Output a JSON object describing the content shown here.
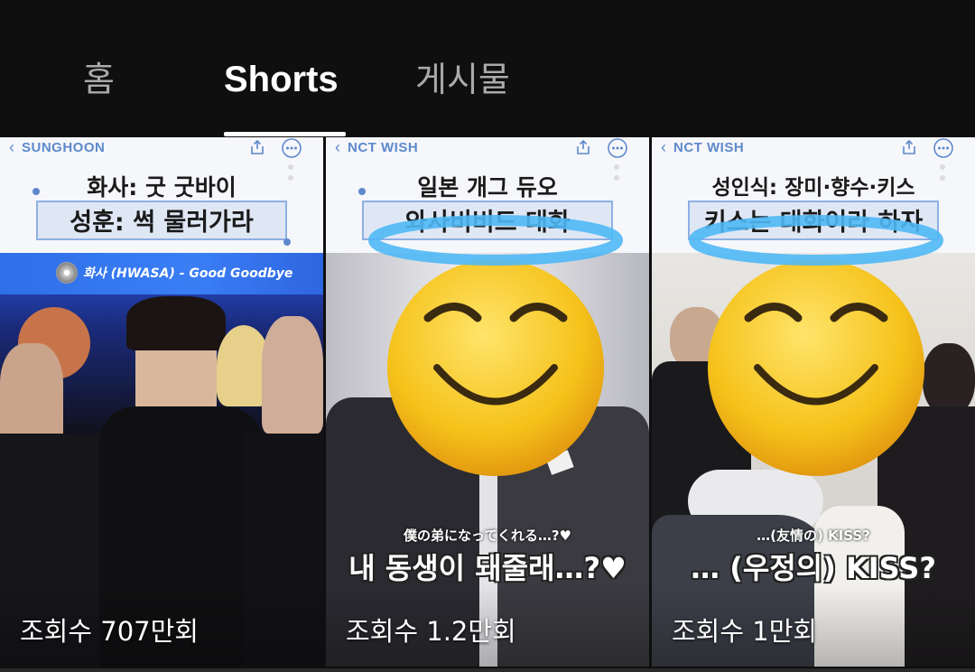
{
  "tabs": {
    "home": "홈",
    "shorts": "Shorts",
    "posts": "게시물"
  },
  "cards": [
    {
      "channel": "SUNGHOON",
      "title_line1": "화사: 굿 굿바이",
      "title_line2": "성훈: 썩 물러가라",
      "song": "화사 (HWASA) - Good Goodbye",
      "views": "조회수 707만회"
    },
    {
      "channel": "NCT WISH",
      "title_line1": "일본 개그 듀오",
      "title_line2": "와사비비드 대화",
      "subtitle_jp": "僕の弟になってくれる…?♥",
      "subtitle_kr": "내 동생이 돼줄래…?♥",
      "views": "조회수 1.2만회"
    },
    {
      "channel": "NCT WISH",
      "title_line1": "성인식: 장미·향수·키스",
      "title_line2": "키스는 대화이라 하자",
      "subtitle_jp": "…(友情の) KISS?",
      "subtitle_kr": "… (우정의) KISS?",
      "views": "조회수 1만회"
    }
  ],
  "icons": [
    "chevron-left-icon",
    "share-icon",
    "more-icon",
    "cd-icon",
    "halo-smiley-emoji"
  ],
  "colors": {
    "background": "#0f0f0f",
    "accent_blue": "#5d89cc",
    "inactive_tab": "#aaaaaa"
  }
}
